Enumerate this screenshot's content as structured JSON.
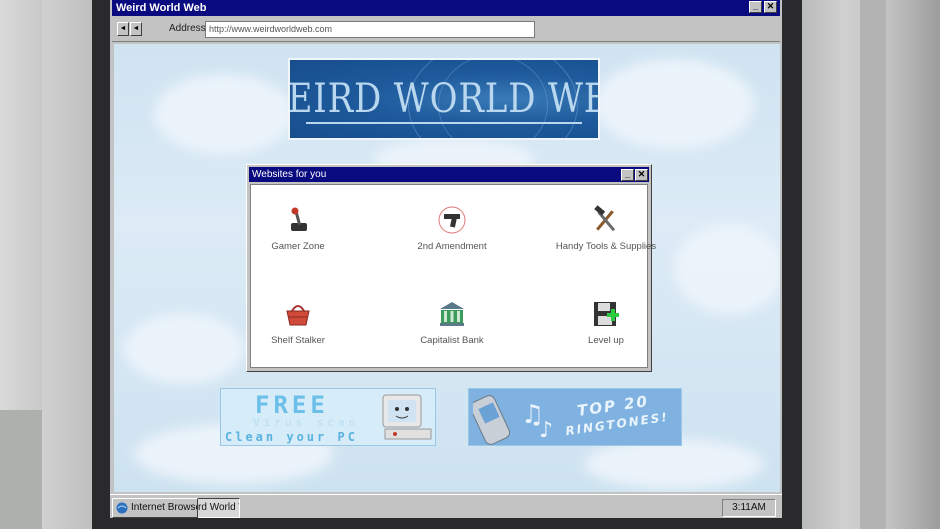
{
  "window": {
    "title": "Weird World Web",
    "minimize_icon": "minimize-icon",
    "close_icon": "close-icon"
  },
  "toolbar": {
    "back_icon": "back-arrow-icon",
    "forward_icon": "back-arrow-icon",
    "address_label": "Address:",
    "address_value": "http://www.weirdworldweb.com"
  },
  "page": {
    "logo_text": "WEIRD WORLD WEB",
    "popup": {
      "title": "Websites for you",
      "sites": [
        {
          "label": "Gamer Zone",
          "icon": "joystick-icon"
        },
        {
          "label": "2nd Amendment",
          "icon": "pistol-icon"
        },
        {
          "label": "Handy Tools & Supplies",
          "icon": "tools-icon"
        },
        {
          "label": "Shelf Stalker",
          "icon": "shopping-basket-icon"
        },
        {
          "label": "Capitalist Bank",
          "icon": "bank-icon"
        },
        {
          "label": "Level up",
          "icon": "floppy-disk-plus-icon"
        }
      ]
    },
    "banners": {
      "virus": {
        "line1": "FREE",
        "line2": "Virus scan",
        "line3": "Clean your PC"
      },
      "ringtones": {
        "line1": "TOP 20",
        "line2": "RINGTONES!"
      }
    }
  },
  "taskbar": {
    "items": [
      "Internet Browser",
      "Weird World Web"
    ],
    "clock": "3:11AM"
  },
  "colors": {
    "title_bar": "#0a0a80",
    "window_chrome": "#c3c3c3",
    "page_background": "#d6e8f5"
  }
}
